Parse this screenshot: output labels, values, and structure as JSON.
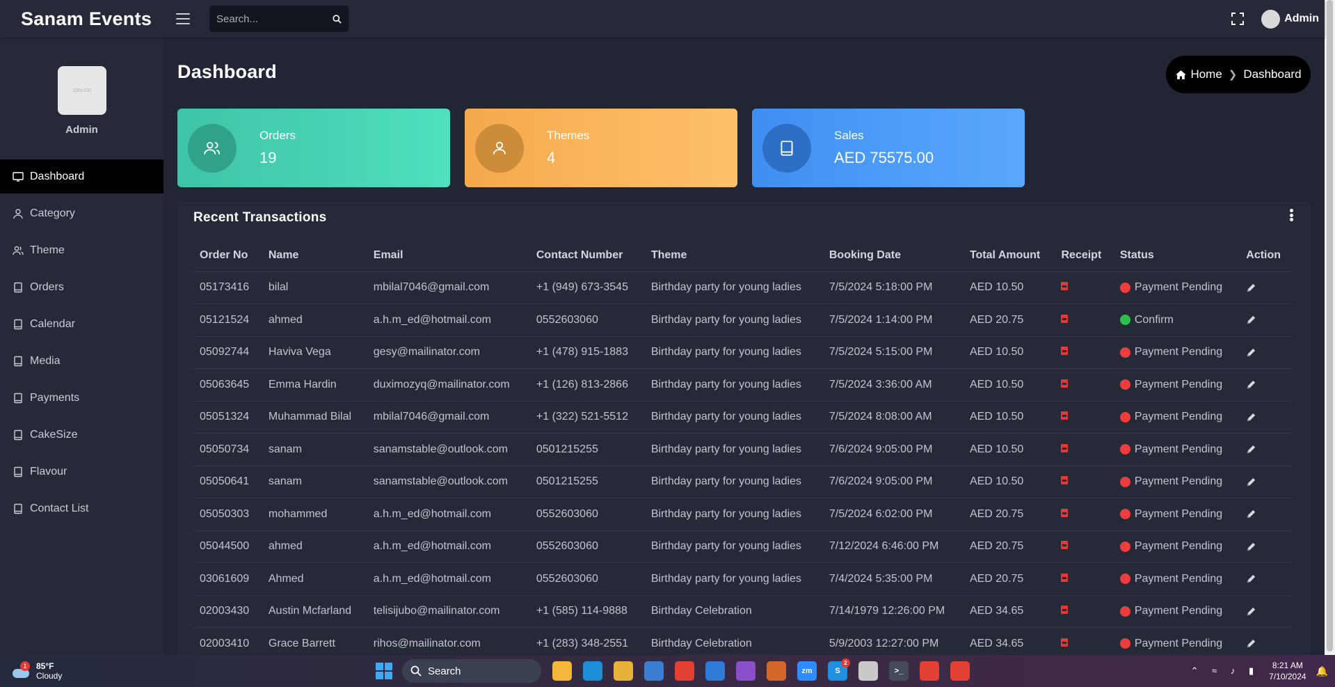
{
  "app": {
    "brand": "Sanam Events",
    "search_placeholder": "Search...",
    "admin_name": "Admin"
  },
  "sidebar": {
    "profile_name": "Admin",
    "profile_img_text": "100x100",
    "items": [
      {
        "label": "Dashboard",
        "icon": "monitor-icon",
        "active": true
      },
      {
        "label": "Category",
        "icon": "user-icon"
      },
      {
        "label": "Theme",
        "icon": "users-icon"
      },
      {
        "label": "Orders",
        "icon": "book-icon"
      },
      {
        "label": "Calendar",
        "icon": "book-icon"
      },
      {
        "label": "Media",
        "icon": "book-icon"
      },
      {
        "label": "Payments",
        "icon": "book-icon"
      },
      {
        "label": "CakeSize",
        "icon": "book-icon"
      },
      {
        "label": "Flavour",
        "icon": "book-icon"
      },
      {
        "label": "Contact List",
        "icon": "book-icon"
      }
    ]
  },
  "page": {
    "title": "Dashboard",
    "breadcrumb_home": "Home",
    "breadcrumb_current": "Dashboard"
  },
  "cards": [
    {
      "label": "Orders",
      "value": "19",
      "icon": "users-icon",
      "color": "#4fe0be"
    },
    {
      "label": "Themes",
      "value": "4",
      "icon": "user-icon",
      "color": "#ffc16a"
    },
    {
      "label": "Sales",
      "value": "AED 75575.00",
      "icon": "book-icon",
      "color": "#5aa8fd"
    }
  ],
  "transactions": {
    "title": "Recent Transactions",
    "columns": [
      "Order No",
      "Name",
      "Email",
      "Contact Number",
      "Theme",
      "Booking Date",
      "Total Amount",
      "Receipt",
      "Status",
      "Action"
    ],
    "rows": [
      {
        "order_no": "05173416",
        "name": "bilal",
        "email": "mbilal7046@gmail.com",
        "contact": "+1 (949) 673-3545",
        "theme": "Birthday party for young ladies",
        "date": "7/5/2024 5:18:00 PM",
        "amount": "AED 10.50",
        "status": "Payment Pending",
        "status_color": "red"
      },
      {
        "order_no": "05121524",
        "name": "ahmed",
        "email": "a.h.m_ed@hotmail.com",
        "contact": "0552603060",
        "theme": "Birthday party for young ladies",
        "date": "7/5/2024 1:14:00 PM",
        "amount": "AED 20.75",
        "status": "Confirm",
        "status_color": "green"
      },
      {
        "order_no": "05092744",
        "name": "Haviva Vega",
        "email": "gesy@mailinator.com",
        "contact": "+1 (478) 915-1883",
        "theme": "Birthday party for young ladies",
        "date": "7/5/2024 5:15:00 PM",
        "amount": "AED 10.50",
        "status": "Payment Pending",
        "status_color": "red"
      },
      {
        "order_no": "05063645",
        "name": "Emma Hardin",
        "email": "duximozyq@mailinator.com",
        "contact": "+1 (126) 813-2866",
        "theme": "Birthday party for young ladies",
        "date": "7/5/2024 3:36:00 AM",
        "amount": "AED 10.50",
        "status": "Payment Pending",
        "status_color": "red"
      },
      {
        "order_no": "05051324",
        "name": "Muhammad Bilal",
        "email": "mbilal7046@gmail.com",
        "contact": "+1 (322) 521-5512",
        "theme": "Birthday party for young ladies",
        "date": "7/5/2024 8:08:00 AM",
        "amount": "AED 10.50",
        "status": "Payment Pending",
        "status_color": "red"
      },
      {
        "order_no": "05050734",
        "name": "sanam",
        "email": "sanamstable@outlook.com",
        "contact": "0501215255",
        "theme": "Birthday party for young ladies",
        "date": "7/6/2024 9:05:00 PM",
        "amount": "AED 10.50",
        "status": "Payment Pending",
        "status_color": "red"
      },
      {
        "order_no": "05050641",
        "name": "sanam",
        "email": "sanamstable@outlook.com",
        "contact": "0501215255",
        "theme": "Birthday party for young ladies",
        "date": "7/6/2024 9:05:00 PM",
        "amount": "AED 10.50",
        "status": "Payment Pending",
        "status_color": "red"
      },
      {
        "order_no": "05050303",
        "name": "mohammed",
        "email": "a.h.m_ed@hotmail.com",
        "contact": "0552603060",
        "theme": "Birthday party for young ladies",
        "date": "7/5/2024 6:02:00 PM",
        "amount": "AED 20.75",
        "status": "Payment Pending",
        "status_color": "red"
      },
      {
        "order_no": "05044500",
        "name": "ahmed",
        "email": "a.h.m_ed@hotmail.com",
        "contact": "0552603060",
        "theme": "Birthday party for young ladies",
        "date": "7/12/2024 6:46:00 PM",
        "amount": "AED 20.75",
        "status": "Payment Pending",
        "status_color": "red"
      },
      {
        "order_no": "03061609",
        "name": "Ahmed",
        "email": "a.h.m_ed@hotmail.com",
        "contact": "0552603060",
        "theme": "Birthday party for young ladies",
        "date": "7/4/2024 5:35:00 PM",
        "amount": "AED 20.75",
        "status": "Payment Pending",
        "status_color": "red"
      },
      {
        "order_no": "02003430",
        "name": "Austin Mcfarland",
        "email": "telisijubo@mailinator.com",
        "contact": "+1 (585) 114-9888",
        "theme": "Birthday Celebration",
        "date": "7/14/1979 12:26:00 PM",
        "amount": "AED 34.65",
        "status": "Payment Pending",
        "status_color": "red"
      },
      {
        "order_no": "02003410",
        "name": "Grace Barrett",
        "email": "rihos@mailinator.com",
        "contact": "+1 (283) 348-2551",
        "theme": "Birthday Celebration",
        "date": "5/9/2003 12:27:00 PM",
        "amount": "AED 34.65",
        "status": "Payment Pending",
        "status_color": "red"
      }
    ]
  },
  "taskbar": {
    "weather_temp": "85°F",
    "weather_desc": "Cloudy",
    "weather_badge": "1",
    "search_label": "Search",
    "apps": [
      {
        "name": "file-explorer-icon",
        "color": "#f4b73a",
        "text": ""
      },
      {
        "name": "edge-icon",
        "color": "#1d8fd8",
        "text": ""
      },
      {
        "name": "folder-icon",
        "color": "#e8b23a",
        "text": ""
      },
      {
        "name": "store-icon",
        "color": "#3b7fd4",
        "text": ""
      },
      {
        "name": "chrome-icon",
        "color": "#e34133",
        "text": ""
      },
      {
        "name": "mail-icon",
        "color": "#2f7ad6",
        "text": ""
      },
      {
        "name": "visual-studio-icon",
        "color": "#8a4fc9",
        "text": ""
      },
      {
        "name": "snipping-tool-icon",
        "color": "#d4672a",
        "text": ""
      },
      {
        "name": "zoom-icon",
        "color": "#2d8cff",
        "text": "zm"
      },
      {
        "name": "skype-icon",
        "color": "#1e90e0",
        "text": "S",
        "badge": "2"
      },
      {
        "name": "solitaire-icon",
        "color": "#c9c9c9",
        "text": ""
      },
      {
        "name": "terminal-icon",
        "color": "#444b5c",
        "text": ">_"
      },
      {
        "name": "chrome-icon-2",
        "color": "#e34133",
        "text": ""
      },
      {
        "name": "chrome-icon-3",
        "color": "#e34133",
        "text": ""
      }
    ],
    "time": "8:21 AM",
    "date": "7/10/2024"
  }
}
